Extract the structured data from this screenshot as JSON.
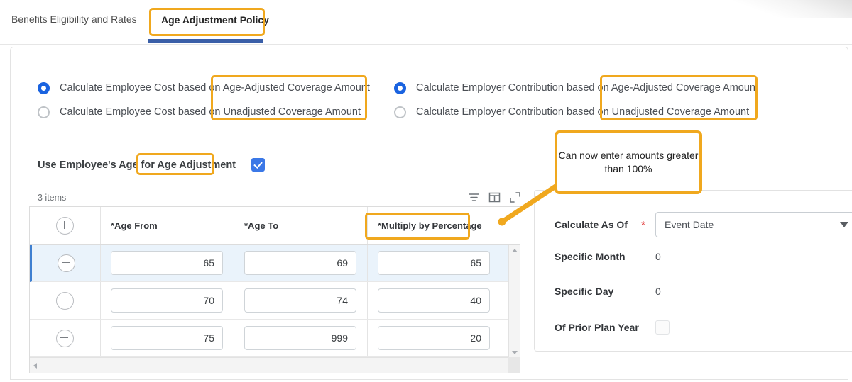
{
  "tabs": {
    "inactive_label": "Benefits Eligibility and Rates",
    "active_label": "Age Adjustment Policy"
  },
  "employee_cost": {
    "options": [
      {
        "label": "Calculate Employee Cost based on Age-Adjusted Coverage Amount",
        "selected": true
      },
      {
        "label": "Calculate Employee Cost based on Unadjusted Coverage Amount",
        "selected": false
      }
    ]
  },
  "employer_contribution": {
    "options": [
      {
        "label": "Calculate Employer Contribution based on Age-Adjusted Coverage Amount",
        "selected": true
      },
      {
        "label": "Calculate Employer Contribution based on Unadjusted Coverage Amount",
        "selected": false
      }
    ]
  },
  "use_employee_age": {
    "label": "Use Employee's Age for Age Adjustment",
    "checked": true
  },
  "grid": {
    "items_count": "3 items",
    "tool_icons": [
      "filter-icon",
      "column-config-icon",
      "expand-icon"
    ],
    "add_row_icon": "plus-circle-icon",
    "remove_row_icon": "minus-circle-icon",
    "columns": [
      "*Age From",
      "*Age To",
      "*Multiply by Percentage"
    ],
    "rows": [
      {
        "age_from": "65",
        "age_to": "69",
        "multiply_by_percentage": "65",
        "selected": true
      },
      {
        "age_from": "70",
        "age_to": "74",
        "multiply_by_percentage": "40",
        "selected": false
      },
      {
        "age_from": "75",
        "age_to": "999",
        "multiply_by_percentage": "20",
        "selected": false
      }
    ]
  },
  "right_panel": {
    "calculate_as_of": {
      "label": "Calculate As Of",
      "required_marker": "*",
      "value": "Event Date",
      "caret_icon": "chevron-down-icon"
    },
    "specific_month": {
      "label": "Specific Month",
      "value": "0"
    },
    "specific_day": {
      "label": "Specific Day",
      "value": "0"
    },
    "of_prior_plan_year": {
      "label": "Of Prior Plan Year",
      "checked": false
    }
  },
  "annotations": {
    "callout_text": "Can now enter amounts greater than 100%",
    "highlight_color": "#f0a81e"
  }
}
